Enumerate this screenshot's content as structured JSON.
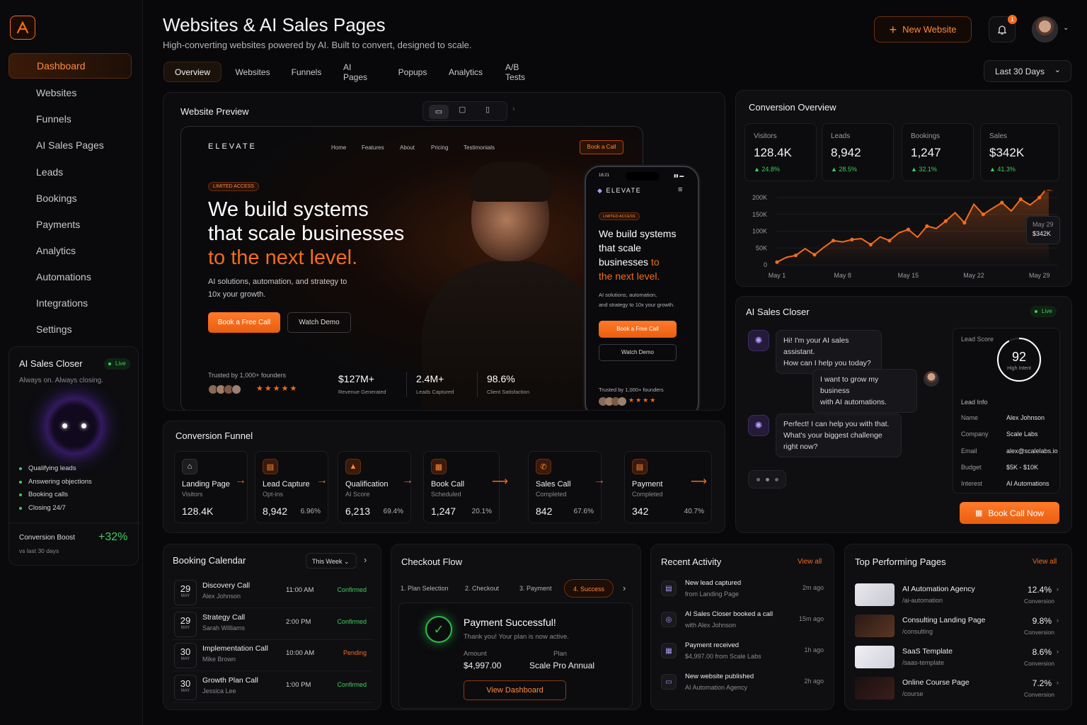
{
  "header": {
    "title": "Websites & AI Sales Pages",
    "subtitle": "High-converting websites powered by AI. Built to convert, designed to scale.",
    "new_button": "New Website",
    "notif_count": "1",
    "range": "Last 30 Days"
  },
  "sidebar": {
    "items": [
      {
        "label": "Dashboard",
        "icon": "home-icon"
      },
      {
        "label": "Websites",
        "icon": "browser-icon"
      },
      {
        "label": "Funnels",
        "icon": "funnel-icon"
      },
      {
        "label": "AI Sales Pages",
        "icon": "funnel-icon"
      },
      {
        "label": "Leads",
        "icon": "users-icon"
      },
      {
        "label": "Bookings",
        "icon": "calendar-icon"
      },
      {
        "label": "Payments",
        "icon": "card-icon"
      },
      {
        "label": "Analytics",
        "icon": "bar-chart-icon"
      },
      {
        "label": "Automations",
        "icon": "nodes-icon"
      },
      {
        "label": "Integrations",
        "icon": "gear-icon"
      },
      {
        "label": "Settings",
        "icon": "gear-icon"
      }
    ],
    "closer": {
      "title": "AI Sales Closer",
      "live": "Live",
      "tagline": "Always on. Always closing.",
      "bullets": [
        "Qualifying leads",
        "Answering objections",
        "Booking calls",
        "Closing 24/7"
      ],
      "boost_label": "Conversion Boost",
      "boost_value": "+32%",
      "boost_sub": "vs last 30 days"
    }
  },
  "tabs": [
    "Overview",
    "Websites",
    "Funnels",
    "AI Pages",
    "Popups",
    "Analytics",
    "A/B Tests"
  ],
  "preview": {
    "title": "Website Preview",
    "brand": "ELEVATE",
    "nav": [
      "Home",
      "Features",
      "About",
      "Pricing",
      "Testimonials"
    ],
    "nav_cta": "Book a Call",
    "badge": "LIMITED ACCESS",
    "headline1": "We build systems",
    "headline2": "that scale businesses",
    "headline3": "to the next level.",
    "body": "AI solutions, automation, and strategy to",
    "body2": "10x your growth.",
    "cta1": "Book a Free Call",
    "cta2": "Watch Demo",
    "trusted": "Trusted by 1,000+ founders",
    "stats": [
      {
        "v": "$127M+",
        "l": "Revenue Generated"
      },
      {
        "v": "2.4M+",
        "l": "Leads Captured"
      },
      {
        "v": "98.6%",
        "l": "Client Satisfaction"
      }
    ],
    "phone": {
      "time": "16:21",
      "brand": "ELEVATE",
      "badge": "LIMITED ACCESS",
      "h1": "We build systems",
      "h2": "that scale",
      "h3": "businesses",
      "h3b": "to",
      "h4": "the next level.",
      "body1": "AI solutions, automation,",
      "body2": "and strategy to 10x your growth.",
      "cta1": "Book a Free Call",
      "cta2": "Watch Demo",
      "trusted": "Trusted by 1,000+ founders"
    }
  },
  "overview": {
    "title": "Conversion Overview",
    "stats": [
      {
        "l": "Visitors",
        "v": "128.4K",
        "c": "▲ 24.8%"
      },
      {
        "l": "Leads",
        "v": "8,942",
        "c": "▲ 28.5%"
      },
      {
        "l": "Bookings",
        "v": "1,247",
        "c": "▲ 32.1%"
      },
      {
        "l": "Sales",
        "v": "$342K",
        "c": "▲ 41.3%"
      }
    ],
    "tooltip_date": "May 29",
    "tooltip_value": "$342K"
  },
  "chart_data": {
    "type": "line",
    "x": [
      "May 1",
      "May 2",
      "May 3",
      "May 4",
      "May 5",
      "May 6",
      "May 7",
      "May 8",
      "May 9",
      "May 10",
      "May 11",
      "May 12",
      "May 13",
      "May 14",
      "May 15",
      "May 16",
      "May 17",
      "May 18",
      "May 19",
      "May 20",
      "May 21",
      "May 22",
      "May 23",
      "May 24",
      "May 25",
      "May 26",
      "May 27",
      "May 28",
      "May 29",
      "May 30"
    ],
    "y": [
      8,
      22,
      28,
      48,
      30,
      52,
      72,
      68,
      75,
      78,
      60,
      83,
      72,
      95,
      105,
      82,
      115,
      108,
      130,
      155,
      125,
      180,
      150,
      168,
      185,
      160,
      195,
      178,
      200,
      235
    ],
    "xticks": [
      "May 1",
      "May 8",
      "May 15",
      "May 22",
      "May 29"
    ],
    "yticks": [
      "0",
      "50K",
      "100K",
      "150K",
      "200K"
    ],
    "ylim": [
      0,
      200
    ],
    "color": "#f26c1d"
  },
  "funnel": {
    "title": "Conversion Funnel",
    "steps": [
      {
        "t": "Landing Page",
        "s": "Visitors",
        "v": "128.4K",
        "p": ""
      },
      {
        "t": "Lead Capture",
        "s": "Opt-ins",
        "v": "8,942",
        "p": "6.96%"
      },
      {
        "t": "Qualification",
        "s": "AI Score",
        "v": "6,213",
        "p": "69.4%"
      },
      {
        "t": "Book Call",
        "s": "Scheduled",
        "v": "1,247",
        "p": "20.1%"
      },
      {
        "t": "Sales Call",
        "s": "Completed",
        "v": "842",
        "p": "67.6%"
      },
      {
        "t": "Payment",
        "s": "Completed",
        "v": "342",
        "p": "40.7%"
      }
    ]
  },
  "closer": {
    "title": "AI Sales Closer",
    "live": "Live",
    "msg1a": "Hi! I'm your AI sales assistant.",
    "msg1b": "How can I help you today?",
    "msg2a": "I want to grow my business",
    "msg2b": "with AI automations.",
    "msg3a": "Perfect! I can help you with that.",
    "msg3b": "What's your biggest challenge",
    "msg3c": "right now?",
    "score_label": "Lead Score",
    "score": "92",
    "score_sub": "High Intent",
    "score_value": 0.92,
    "info_title": "Lead Info",
    "info": [
      {
        "k": "Name",
        "v": "Alex Johnson"
      },
      {
        "k": "Company",
        "v": "Scale Labs"
      },
      {
        "k": "Email",
        "v": "alex@scalelabs.io"
      },
      {
        "k": "Budget",
        "v": "$5K - $10K"
      },
      {
        "k": "Interest",
        "v": "AI Automations"
      }
    ],
    "cta": "Book Call Now"
  },
  "calendar": {
    "title": "Booking Calendar",
    "filter": "This Week",
    "rows": [
      {
        "d": "29",
        "m": "MAY",
        "t": "Discovery Call",
        "n": "Alex Johnson",
        "time": "11:00 AM",
        "s": "Confirmed"
      },
      {
        "d": "29",
        "m": "MAY",
        "t": "Strategy Call",
        "n": "Sarah Williams",
        "time": "2:00 PM",
        "s": "Confirmed"
      },
      {
        "d": "30",
        "m": "MAY",
        "t": "Implementation Call",
        "n": "Mike Brown",
        "time": "10:00 AM",
        "s": "Pending"
      },
      {
        "d": "30",
        "m": "MAY",
        "t": "Growth Plan Call",
        "n": "Jessica Lee",
        "time": "1:00 PM",
        "s": "Confirmed"
      }
    ]
  },
  "checkout": {
    "title": "Checkout Flow",
    "steps": [
      "1. Plan Selection",
      "2. Checkout",
      "3. Payment",
      "4. Success"
    ],
    "success_title": "Payment Successful!",
    "success_sub": "Thank you! Your plan is now active.",
    "amount_label": "Amount",
    "amount": "$4,997.00",
    "plan_label": "Plan",
    "plan": "Scale Pro Annual",
    "cta": "View Dashboard"
  },
  "activity": {
    "title": "Recent Activity",
    "view_all": "View all",
    "rows": [
      {
        "t": "New lead captured",
        "s": "from Landing Page",
        "time": "2m ago"
      },
      {
        "t": "AI Sales Closer booked a call",
        "s": "with Alex Johnson",
        "time": "15m ago"
      },
      {
        "t": "Payment received",
        "s": "$4,997.00 from Scale Labs",
        "time": "1h ago"
      },
      {
        "t": "New website published",
        "s": "AI Automation Agency",
        "time": "2h ago"
      }
    ]
  },
  "top_pages": {
    "title": "Top Performing Pages",
    "view_all": "View all",
    "rows": [
      {
        "t": "AI Automation Agency",
        "u": "/ai-automation",
        "v": "12.4%",
        "c": "Conversion"
      },
      {
        "t": "Consulting Landing Page",
        "u": "/consulting",
        "v": "9.8%",
        "c": "Conversion"
      },
      {
        "t": "SaaS Template",
        "u": "/saas-template",
        "v": "8.6%",
        "c": "Conversion"
      },
      {
        "t": "Online Course Page",
        "u": "/course",
        "v": "7.2%",
        "c": "Conversion"
      }
    ]
  }
}
